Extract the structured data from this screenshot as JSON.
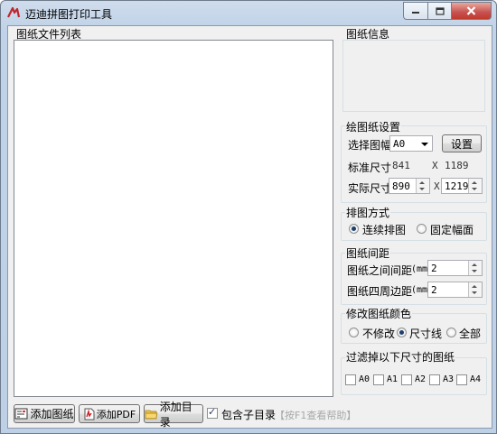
{
  "window": {
    "title": "迈迪拼图打印工具"
  },
  "file_list": {
    "label": "图纸文件列表",
    "items": []
  },
  "info": {
    "label": "图纸信息"
  },
  "settings": {
    "label": "绘图纸设置",
    "paper_size_label": "选择图幅",
    "paper_size_value": "A0",
    "settings_button": "设置",
    "standard_size_label": "标准尺寸",
    "standard_w": "841",
    "standard_x": "X",
    "standard_h": "1189",
    "actual_size_label": "实际尺寸",
    "actual_w": "890",
    "actual_x": "X",
    "actual_h": "1219"
  },
  "layout_mode": {
    "label": "排图方式",
    "continuous": "连续排图",
    "fixed": "固定幅面",
    "selected": "continuous"
  },
  "spacing": {
    "label": "图纸间距",
    "between_label": "图纸之间间距",
    "between_unit": "(mm)",
    "between_value": "2",
    "margin_label": "图纸四周边距",
    "margin_unit": "(mm)",
    "margin_value": "2"
  },
  "color": {
    "label": "修改图纸颜色",
    "none": "不修改",
    "dimension": "尺寸线",
    "all": "全部",
    "selected": "dimension"
  },
  "filter": {
    "label": "过滤掉以下尺寸的图纸",
    "sizes": [
      "A0",
      "A1",
      "A2",
      "A3",
      "A4"
    ]
  },
  "toolbar": {
    "add_drawing": "添加图纸",
    "add_pdf": "添加PDF",
    "add_dir": "添加目录",
    "include_subdir": "包含子目录",
    "include_subdir_checked": true,
    "help_hint": "【按F1查看帮助】"
  }
}
